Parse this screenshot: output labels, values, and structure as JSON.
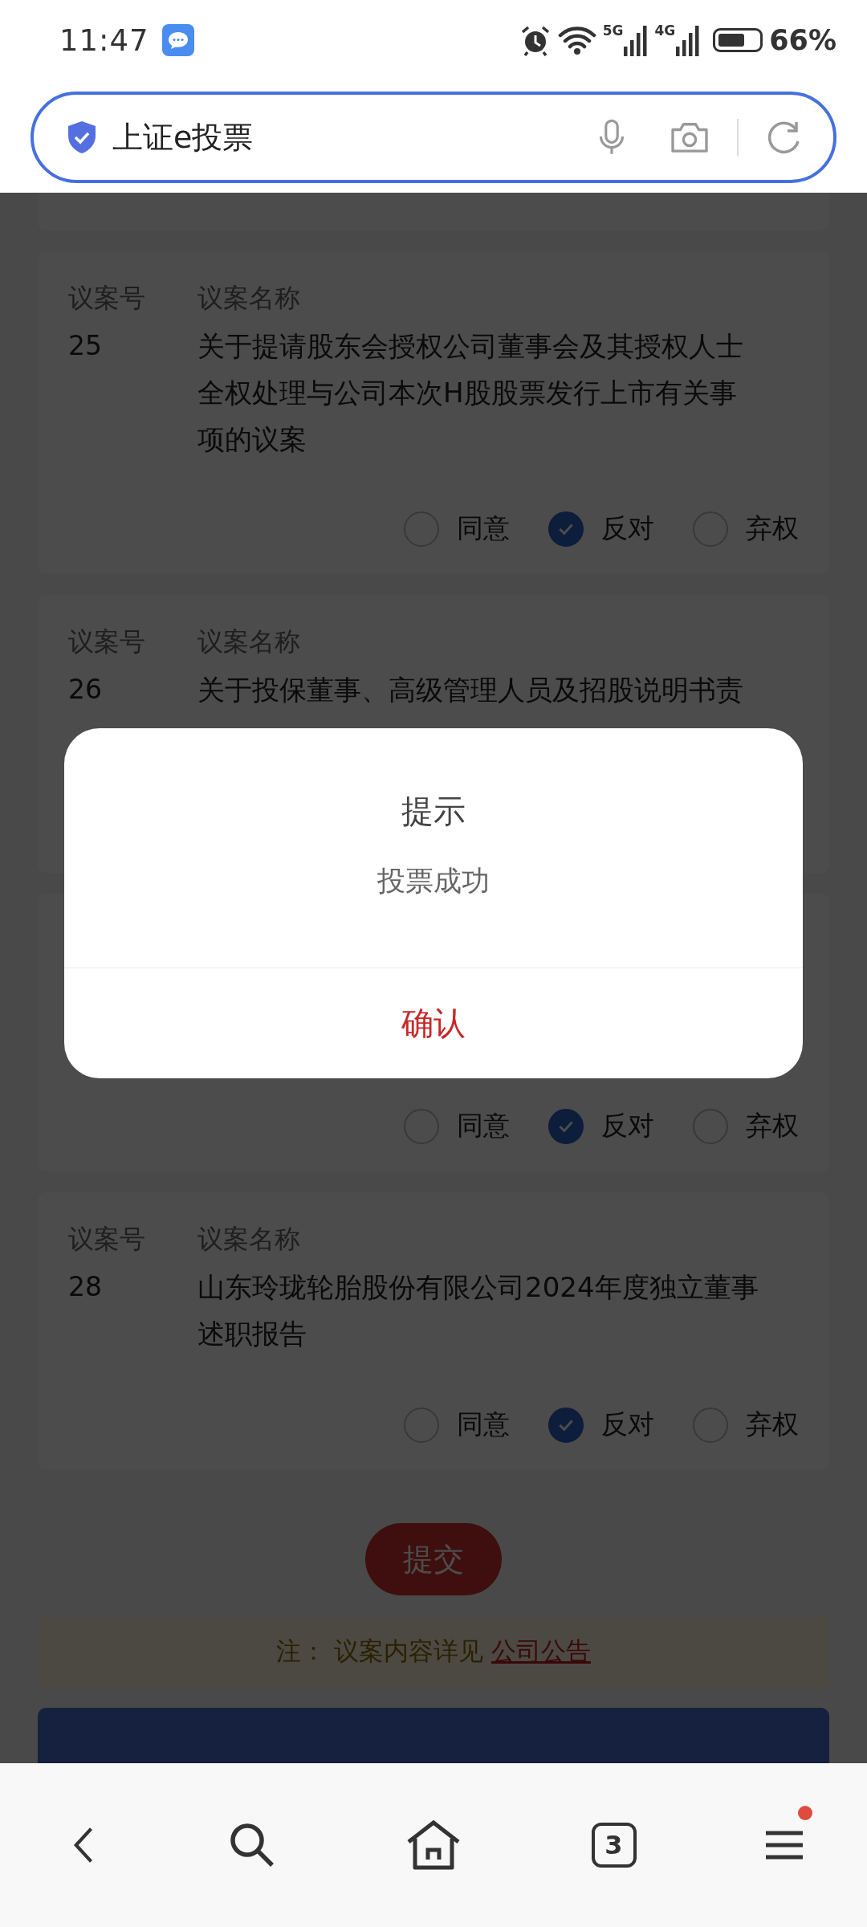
{
  "status_bar": {
    "time": "11:47",
    "signals": [
      "5G",
      "4G"
    ],
    "battery": "66%"
  },
  "address_bar": {
    "text": "上证e投票"
  },
  "proposals": [
    {
      "number_label": "议案号",
      "name_label": "议案名称",
      "number": "25",
      "title": "关于提请股东会授权公司董事会及其授权人士全权处理与公司本次H股股票发行上市有关事项的议案",
      "options": [
        {
          "label": "同意",
          "selected": false
        },
        {
          "label": "反对",
          "selected": true
        },
        {
          "label": "弃权",
          "selected": false
        }
      ]
    },
    {
      "number_label": "议案号",
      "name_label": "议案名称",
      "number": "26",
      "title": "关于投保董事、高级管理人员及招股说明书责"
    },
    {
      "options": [
        {
          "label": "同意",
          "selected": false
        },
        {
          "label": "反对",
          "selected": true
        },
        {
          "label": "弃权",
          "selected": false
        }
      ]
    },
    {
      "number_label": "议案号",
      "name_label": "议案名称",
      "number": "28",
      "title": "山东玲珑轮胎股份有限公司2024年度独立董事述职报告",
      "options": [
        {
          "label": "同意",
          "selected": false
        },
        {
          "label": "反对",
          "selected": true
        },
        {
          "label": "弃权",
          "selected": false
        }
      ]
    }
  ],
  "submit_button": "提交",
  "note": {
    "text": "注： 议案内容详见",
    "link": "公司公告"
  },
  "dialog": {
    "title": "提示",
    "message": "投票成功",
    "confirm": "确认"
  },
  "nav": {
    "tab_count": "3",
    "menu_badge": true
  }
}
